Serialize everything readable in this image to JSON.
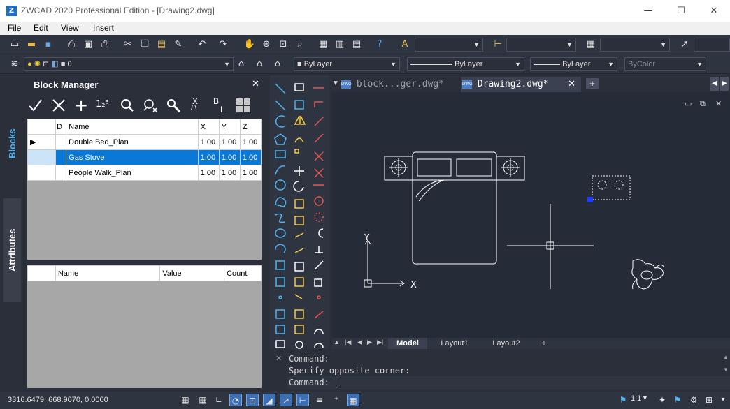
{
  "titlebar": {
    "logo": "Z",
    "title": "ZWCAD 2020 Professional Edition - [Drawing2.dwg]",
    "minimize": "—",
    "maximize": "☐",
    "close": "✕"
  },
  "menu": {
    "file": "File",
    "edit": "Edit",
    "view": "View",
    "insert": "Insert"
  },
  "properties": {
    "layer": "0",
    "color": "ByLayer",
    "linetype": "ByLayer",
    "lineweight": "ByLayer",
    "plotstyle": "ByColor"
  },
  "block_manager": {
    "title": "Block Manager",
    "close": "✕",
    "tabs": {
      "blocks": "Blocks",
      "attributes": "Attributes"
    },
    "tool_icons": [
      "check-icon",
      "cross-icon",
      "plus-icon",
      "renumber-icon",
      "search-icon",
      "search-clear-icon",
      "find-icon",
      "xbl-icon",
      "grid-view-icon"
    ],
    "tool_glyphs": {
      "plus": "+",
      "renumber": "1₂³",
      "xbl_x": "X",
      "xbl_b": "B",
      "xbl_l": "L"
    },
    "blocks_table": {
      "columns": [
        "D",
        "Name",
        "X",
        "Y",
        "Z"
      ],
      "rows": [
        {
          "name": "Double Bed_Plan",
          "x": "1.00",
          "y": "1.00",
          "z": "1.00",
          "current": true
        },
        {
          "name": "Gas Stove",
          "x": "1.00",
          "y": "1.00",
          "z": "1.00",
          "selected": true
        },
        {
          "name": "People Walk_Plan",
          "x": "1.00",
          "y": "1.00",
          "z": "1.00"
        }
      ]
    },
    "attributes_table": {
      "columns": [
        "Name",
        "Value",
        "Count"
      ]
    }
  },
  "doc_tabs": [
    {
      "label": "block...ger.dwg*",
      "active": false
    },
    {
      "label": "Drawing2.dwg*",
      "active": true
    }
  ],
  "doc_tab_close": "✕",
  "doc_tab_add": "+",
  "dwg_badge": "DWG",
  "viewport_controls": {
    "minimize": "▭",
    "restore": "⧉",
    "close": "✕"
  },
  "canvas": {
    "ucs_x": "X",
    "ucs_y": "Y"
  },
  "layout_tabs": {
    "model": "Model",
    "layout1": "Layout1",
    "layout2": "Layout2",
    "add": "+"
  },
  "command": {
    "lines": [
      "Command:",
      "Specify opposite corner:"
    ],
    "prompt": "Command:"
  },
  "status": {
    "coords": "3316.6479, 668.9070, 0.0000",
    "scale": "1:1"
  }
}
